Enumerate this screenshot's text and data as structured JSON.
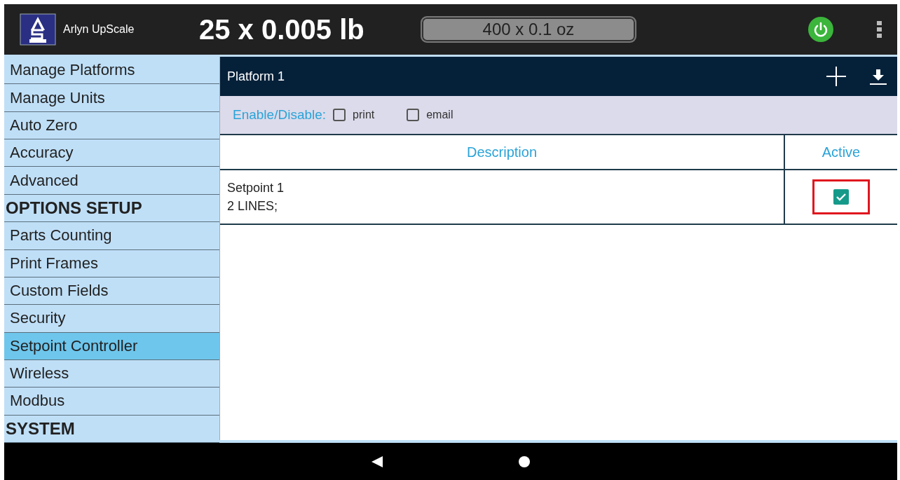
{
  "app_bar": {
    "title": "Arlyn UpScale",
    "primary_reading": "25 x 0.005 lb",
    "secondary_reading": "400 x 0.1 oz"
  },
  "sidebar": {
    "items": [
      {
        "kind": "item",
        "label": "Manage Platforms",
        "selected": false
      },
      {
        "kind": "item",
        "label": "Manage Units",
        "selected": false
      },
      {
        "kind": "item",
        "label": "Auto Zero",
        "selected": false
      },
      {
        "kind": "item",
        "label": "Accuracy",
        "selected": false
      },
      {
        "kind": "item",
        "label": "Advanced",
        "selected": false
      },
      {
        "kind": "header",
        "label": "OPTIONS SETUP",
        "selected": false
      },
      {
        "kind": "item",
        "label": "Parts Counting",
        "selected": false
      },
      {
        "kind": "item",
        "label": "Print Frames",
        "selected": false
      },
      {
        "kind": "item",
        "label": "Custom Fields",
        "selected": false
      },
      {
        "kind": "item",
        "label": "Security",
        "selected": false
      },
      {
        "kind": "item",
        "label": "Setpoint Controller",
        "selected": true
      },
      {
        "kind": "item",
        "label": "Wireless",
        "selected": false
      },
      {
        "kind": "item",
        "label": "Modbus",
        "selected": false
      },
      {
        "kind": "header",
        "label": "SYSTEM",
        "selected": false
      }
    ]
  },
  "panel": {
    "title": "Platform 1",
    "enable_label": "Enable/Disable:",
    "toggles": [
      {
        "label": "print",
        "checked": false
      },
      {
        "label": "email",
        "checked": false
      }
    ],
    "table": {
      "columns": [
        "Description",
        "Active"
      ],
      "rows": [
        {
          "description": [
            "Setpoint 1",
            "2 LINES;"
          ],
          "active": true,
          "highlighted": true
        }
      ]
    }
  }
}
